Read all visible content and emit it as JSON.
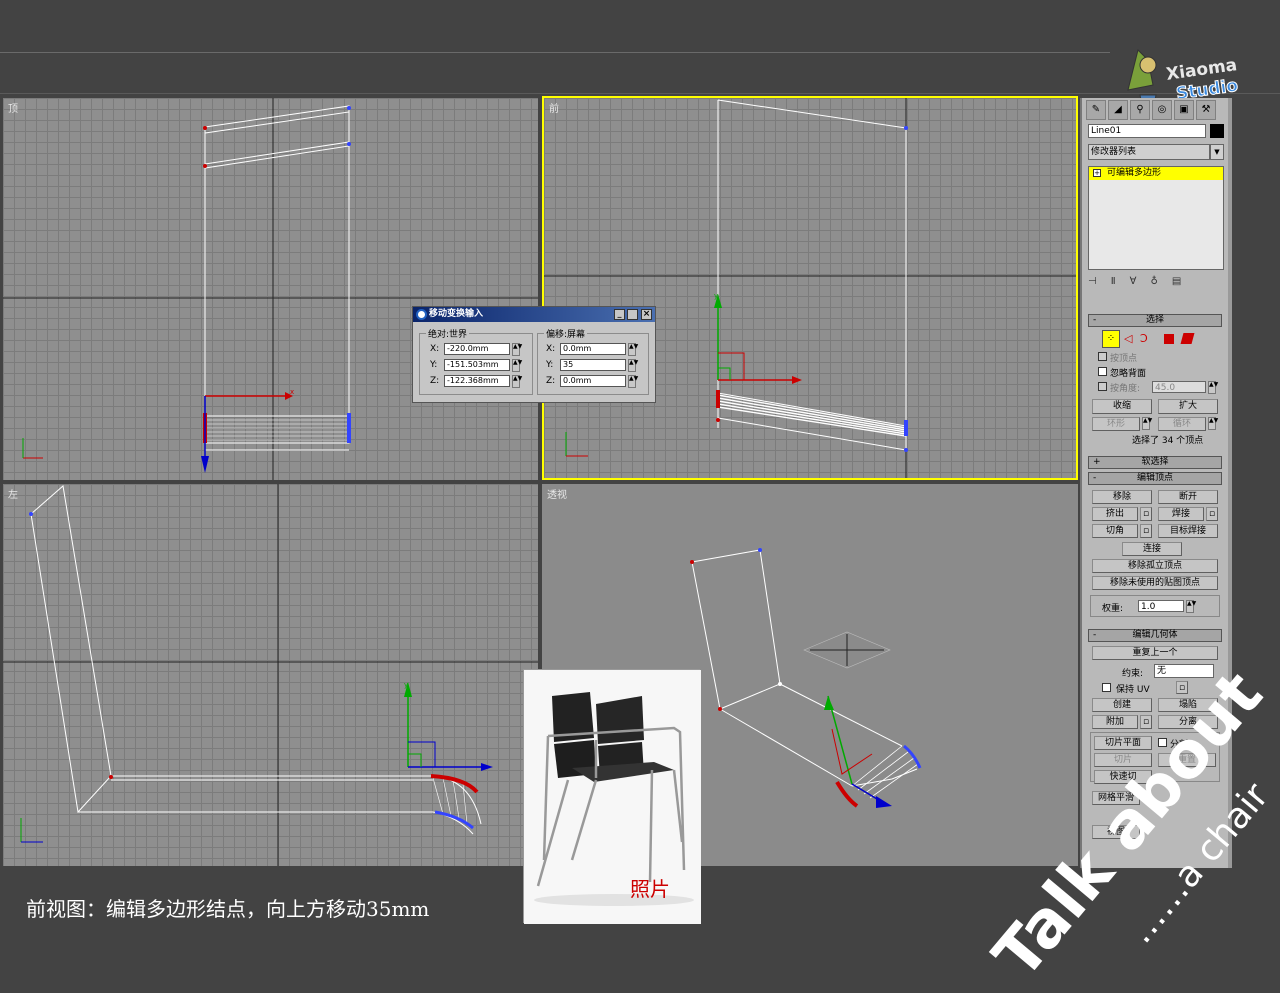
{
  "logo": {
    "line1": "Xiaoma",
    "line2": "Studio"
  },
  "viewports": {
    "top": {
      "label": "顶"
    },
    "front": {
      "label": "前"
    },
    "left": {
      "label": "左"
    },
    "perspective": {
      "label": "透视"
    }
  },
  "axis_labels": {
    "x": "x",
    "y": "y",
    "z": "z"
  },
  "dialog": {
    "title": "移动变换输入",
    "absolute_group": "绝对:世界",
    "offset_group": "偏移:屏幕",
    "abs": [
      {
        "axis": "X:",
        "value": "-220.0mm"
      },
      {
        "axis": "Y:",
        "value": "-151.503mm"
      },
      {
        "axis": "Z:",
        "value": "-122.368mm"
      }
    ],
    "offset": [
      {
        "axis": "X:",
        "value": "0.0mm"
      },
      {
        "axis": "Y:",
        "value": "35"
      },
      {
        "axis": "Z:",
        "value": "0.0mm"
      }
    ]
  },
  "panel": {
    "object_name": "Line01",
    "modifier_list": "修改器列表",
    "stack_item": "可编辑多边形",
    "selection": {
      "title": "选择",
      "by_vertex": "按顶点",
      "ignore_backfacing": "忽略背面",
      "by_angle": "按角度:",
      "angle_value": "45.0",
      "shrink": "收缩",
      "grow": "扩大",
      "ring": "环形",
      "loop": "循环",
      "status": "选择了 34 个顶点"
    },
    "soft_selection": "软选择",
    "edit_vertices": {
      "title": "编辑顶点",
      "remove": "移除",
      "break": "断开",
      "extrude": "挤出",
      "weld": "焊接",
      "chamfer": "切角",
      "target_weld": "目标焊接",
      "connect": "连接",
      "remove_isolated": "移除孤立顶点",
      "remove_unused_map": "移除未使用的贴图顶点",
      "weight_label": "权重:",
      "weight_value": "1.0"
    },
    "edit_geometry": {
      "title": "编辑几何体",
      "repeat_last": "重复上一个",
      "constraints_label": "约束:",
      "constraints_value": "无",
      "preserve_uvs": "保持 UV",
      "create": "创建",
      "collapse": "塌陷",
      "attach": "附加",
      "detach": "分离",
      "slice_plane": "切片平面",
      "split": "分割",
      "slice": "切片",
      "reset": "重置",
      "quick_slice": "快速切",
      "mesh_smooth": "网格平滑",
      "view_align": "视图"
    }
  },
  "photo": {
    "caption": "照片"
  },
  "caption": "前视图：编辑多边形结点，向上方移动35mm",
  "watermark": {
    "big": "Talk about",
    "small": "……a chair"
  },
  "colors": {
    "bg": "#434343",
    "active_border": "#ffff00",
    "stack_highlight": "#ffff00",
    "axis_x": "#cc0000",
    "axis_y": "#00aa00",
    "axis_z": "#0000cc"
  }
}
